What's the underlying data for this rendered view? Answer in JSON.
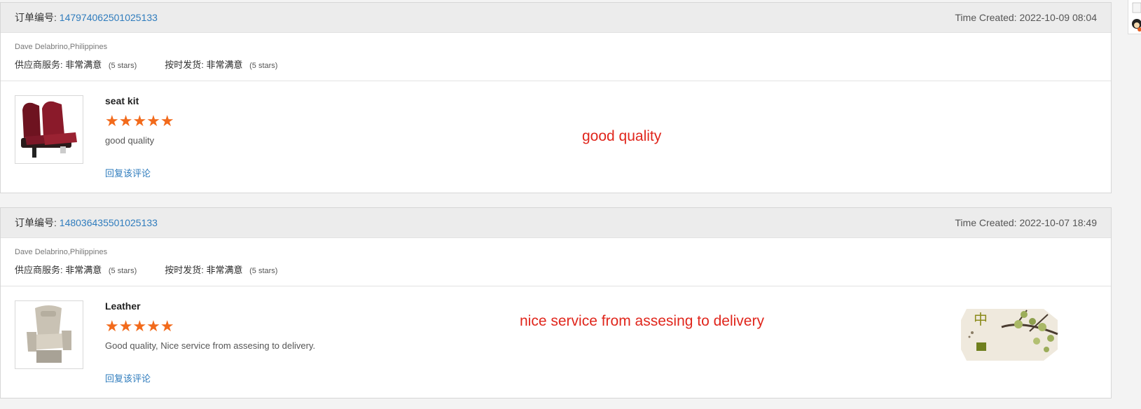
{
  "reviews": [
    {
      "order_label": "订单编号:",
      "order_number": "147974062501025133",
      "time_created": "Time Created: 2022-10-09 08:04",
      "buyer": "Dave Delabrino,Philippines",
      "supplier_service_label": "供应商服务:",
      "supplier_service_value": "非常满意",
      "supplier_service_stars": "(5 stars)",
      "shipping_label": "按时发货:",
      "shipping_value": "非常满意",
      "shipping_stars": "(5 stars)",
      "product_name": "seat kit",
      "rating": 5,
      "stars": "★★★★★",
      "comment": "good quality",
      "reply_label": "回复该评论",
      "annotation": "good quality"
    },
    {
      "order_label": "订单编号:",
      "order_number": "148036435501025133",
      "time_created": "Time Created: 2022-10-07 18:49",
      "buyer": "Dave Delabrino,Philippines",
      "supplier_service_label": "供应商服务:",
      "supplier_service_value": "非常满意",
      "supplier_service_stars": "(5 stars)",
      "shipping_label": "按时发货:",
      "shipping_value": "非常满意",
      "shipping_stars": "(5 stars)",
      "product_name": "Leather",
      "rating": 5,
      "stars": "★★★★★",
      "comment": "Good quality, Nice service from assesing to delivery.",
      "reply_label": "回复该评论",
      "annotation": "nice service from assesing to delivery",
      "sticker_char": "中"
    }
  ],
  "colors": {
    "link": "#2f7cbd",
    "star": "#f26a1b",
    "annotation": "#e0261c"
  }
}
